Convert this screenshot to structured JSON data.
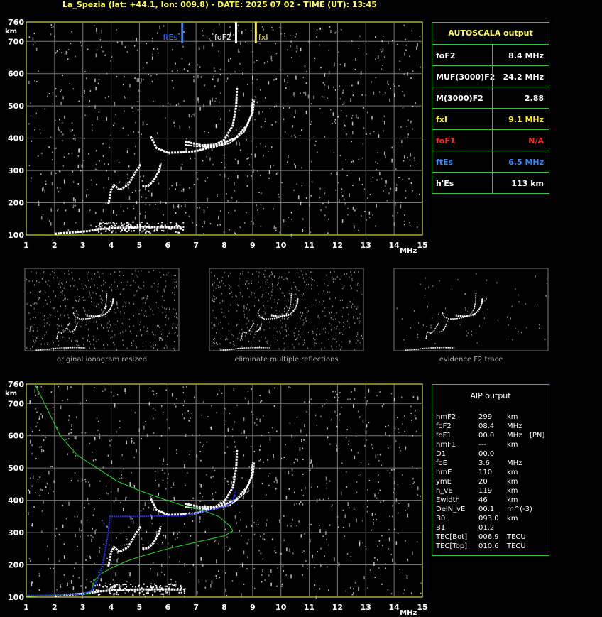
{
  "header": {
    "title": "La_Spezia (lat: +44.1, lon: 009.8) - DATE: 2025 07 02 - TIME (UT): 13:45"
  },
  "chart_data": [
    {
      "type": "scatter",
      "name": "ionogram-autoscala",
      "x_ticks": [
        "1",
        "2",
        "3",
        "4",
        "5",
        "6",
        "7",
        "8",
        "9",
        "10",
        "11",
        "12",
        "13",
        "14",
        "15"
      ],
      "y_ticks": [
        "100",
        "200",
        "300",
        "400",
        "500",
        "600",
        "700",
        "760"
      ],
      "xlabel": "MHz",
      "ylabel": "km",
      "xlim": [
        1,
        15
      ],
      "ylim": [
        100,
        760
      ],
      "markers": [
        {
          "label": "ftEs",
          "freq": 6.5,
          "color": "#2f7fff"
        },
        {
          "label": "foF2",
          "freq": 8.4,
          "color": "#ffffff"
        },
        {
          "label": "fxI",
          "freq": 9.1,
          "color": "#ffee22"
        }
      ]
    },
    {
      "type": "line",
      "name": "ionogram-aip",
      "x_ticks": [
        "1",
        "2",
        "3",
        "4",
        "5",
        "6",
        "7",
        "8",
        "9",
        "10",
        "11",
        "12",
        "13",
        "14",
        "15"
      ],
      "y_ticks": [
        "100",
        "200",
        "300",
        "400",
        "500",
        "600",
        "700",
        "760"
      ],
      "xlabel": "MHz",
      "ylabel": "km",
      "xlim": [
        1,
        15
      ],
      "ylim": [
        100,
        760
      ],
      "series": [
        {
          "color": "#22dd22",
          "points": [
            [
              8.3,
              305
            ],
            [
              8.0,
              290
            ],
            [
              7.0,
              270
            ],
            [
              6.0,
              250
            ],
            [
              5.0,
              225
            ],
            [
              4.5,
              210
            ],
            [
              4.0,
              190
            ],
            [
              3.6,
              170
            ],
            [
              3.4,
              150
            ],
            [
              3.3,
              120
            ],
            [
              3.2,
              110
            ],
            [
              2.0,
              105
            ],
            [
              1.0,
              102
            ]
          ]
        },
        {
          "color": "#22dd22",
          "points": [
            [
              1.3,
              760
            ],
            [
              1.7,
              690
            ],
            [
              2.2,
              600
            ],
            [
              2.8,
              540
            ],
            [
              3.5,
              500
            ],
            [
              4.2,
              460
            ],
            [
              5.0,
              430
            ],
            [
              5.8,
              405
            ],
            [
              6.5,
              385
            ],
            [
              7.2,
              370
            ],
            [
              7.8,
              350
            ],
            [
              8.2,
              320
            ],
            [
              8.3,
              305
            ]
          ]
        },
        {
          "color": "#2233ff",
          "points": [
            [
              1.0,
              105
            ],
            [
              2.0,
              106
            ],
            [
              3.0,
              110
            ],
            [
              3.3,
              120
            ],
            [
              3.5,
              150
            ],
            [
              3.7,
              200
            ],
            [
              3.9,
              300
            ],
            [
              3.95,
              350
            ],
            [
              4.0,
              350
            ],
            [
              5.0,
              350
            ],
            [
              6.0,
              352
            ],
            [
              6.5,
              352
            ],
            [
              7.0,
              360
            ],
            [
              7.5,
              370
            ],
            [
              8.0,
              380
            ],
            [
              8.3,
              395
            ],
            [
              8.4,
              430
            ]
          ]
        }
      ]
    }
  ],
  "autoscala": {
    "title": "AUTOSCALA output",
    "rows": [
      {
        "key": "foF2",
        "value": "8.4 MHz",
        "color": "#ffffff"
      },
      {
        "key": "MUF(3000)F2",
        "value": "24.2 MHz",
        "color": "#ffffff"
      },
      {
        "key": "M(3000)F2",
        "value": "2.88",
        "color": "#ffffff"
      },
      {
        "key": "fxI",
        "value": "9.1 MHz",
        "color": "#ffee22"
      },
      {
        "key": "foF1",
        "value": "N/A",
        "color": "#ff2222"
      },
      {
        "key": "ftEs",
        "value": "6.5 MHz",
        "color": "#3388ff"
      },
      {
        "key": "h'Es",
        "value": "113     km",
        "color": "#ffffff"
      }
    ]
  },
  "thumbnails": [
    {
      "caption": "original ionogram resized"
    },
    {
      "caption": "eliminate multiple reflections"
    },
    {
      "caption": "evidence F2 trace"
    }
  ],
  "aip": {
    "title": "AIP output",
    "rows": [
      {
        "key": "hmF2",
        "value": "299",
        "unit": "km",
        "extra": ""
      },
      {
        "key": "foF2",
        "value": "08.4",
        "unit": "MHz",
        "extra": ""
      },
      {
        "key": "foF1",
        "value": "00.0",
        "unit": "MHz",
        "extra": "[PN]"
      },
      {
        "key": "hmF1",
        "value": "---",
        "unit": "km",
        "extra": ""
      },
      {
        "key": "D1",
        "value": "00.0",
        "unit": "",
        "extra": ""
      },
      {
        "key": "foE",
        "value": "3.6",
        "unit": "MHz",
        "extra": ""
      },
      {
        "key": "hmE",
        "value": "110",
        "unit": "km",
        "extra": ""
      },
      {
        "key": "ymE",
        "value": "20",
        "unit": "km",
        "extra": ""
      },
      {
        "key": "h_vE",
        "value": "119",
        "unit": "km",
        "extra": ""
      },
      {
        "key": "Ewidth",
        "value": "46",
        "unit": "km",
        "extra": ""
      },
      {
        "key": "DelN_vE",
        "value": "00.1",
        "unit": "m^(-3)",
        "extra": ""
      },
      {
        "key": "B0",
        "value": "093.0",
        "unit": "km",
        "extra": ""
      },
      {
        "key": "B1",
        "value": "01.2",
        "unit": "",
        "extra": ""
      },
      {
        "key": "TEC[Bot]",
        "value": "006.9",
        "unit": "TECU",
        "extra": ""
      },
      {
        "key": "TEC[Top]",
        "value": "010.6",
        "unit": "TECU",
        "extra": ""
      }
    ]
  }
}
